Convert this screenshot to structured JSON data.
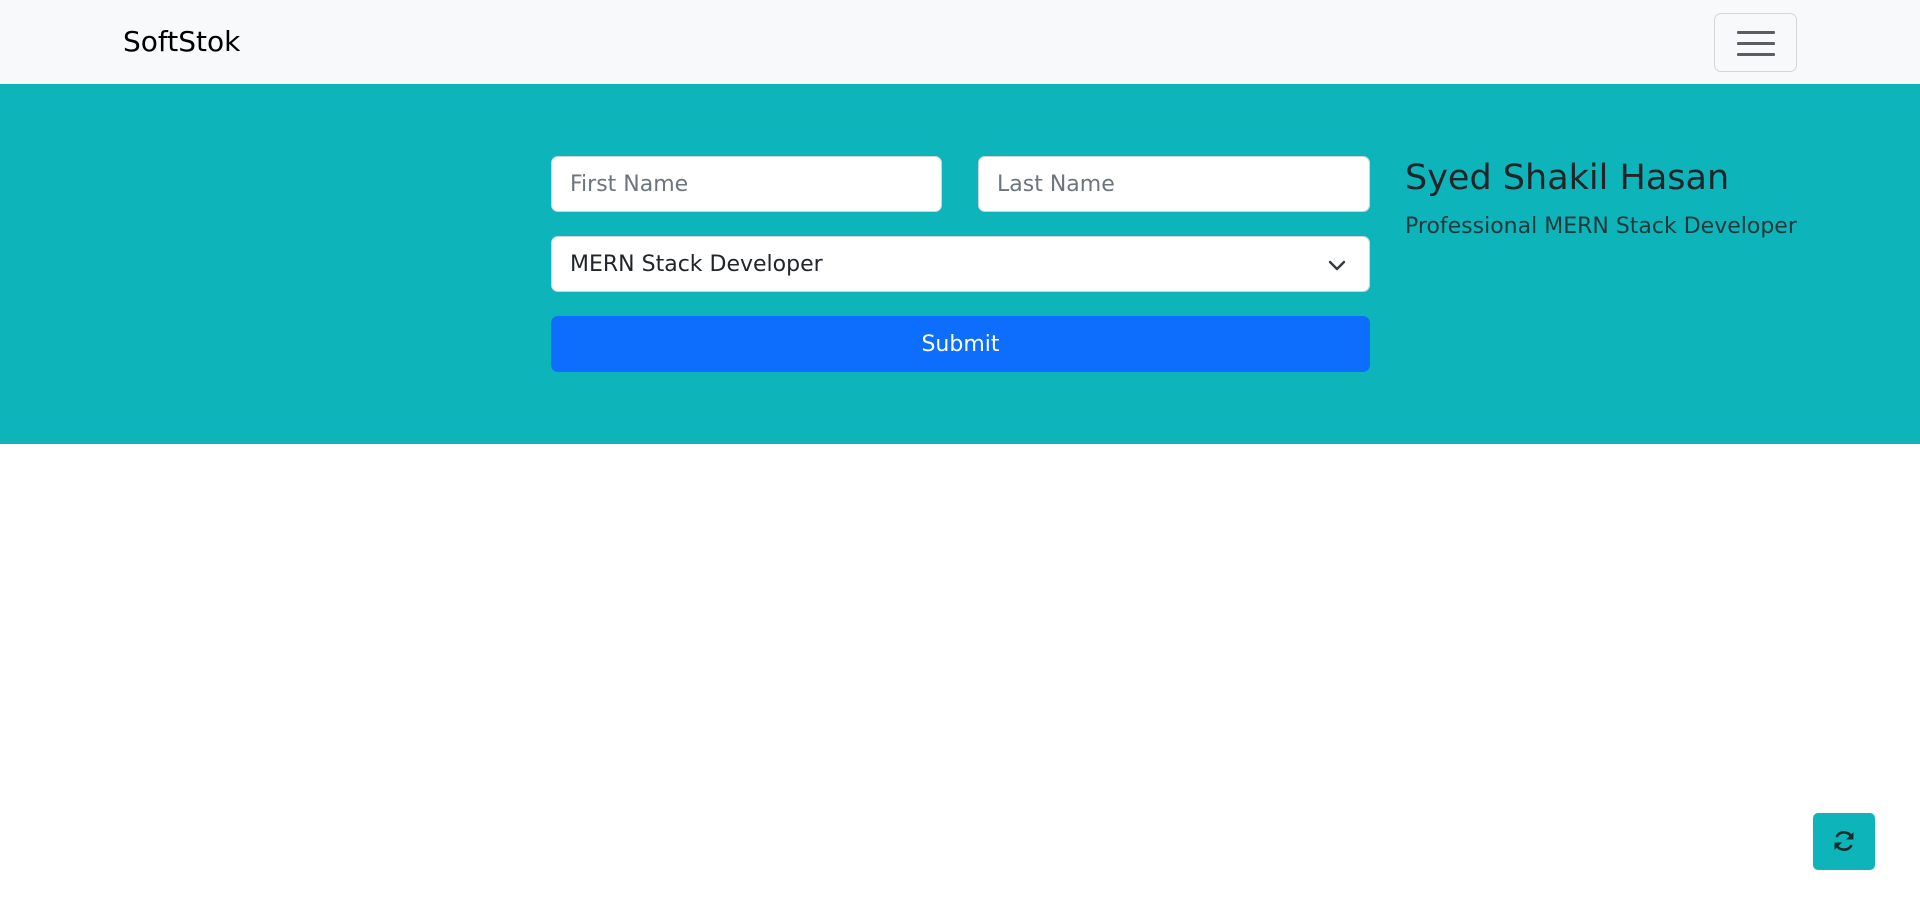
{
  "navbar": {
    "brand": "SoftStok",
    "toggler_icon": "hamburger-menu-icon"
  },
  "form": {
    "first_name_placeholder": "First Name",
    "first_name_value": "",
    "last_name_placeholder": "Last Name",
    "last_name_value": "",
    "role_selected": "MERN Stack Developer",
    "role_icon": "chevron-down-icon",
    "submit_label": "Submit"
  },
  "profile": {
    "name": "Syed Shakil Hasan",
    "title": "Professional MERN Stack Developer"
  },
  "floating_button": {
    "icon": "refresh-icon"
  },
  "colors": {
    "navbar_bg": "#f8f9fa",
    "hero_bg": "#0db5bb",
    "primary": "#0d6efd",
    "refresh_bg": "#0db5bb"
  }
}
